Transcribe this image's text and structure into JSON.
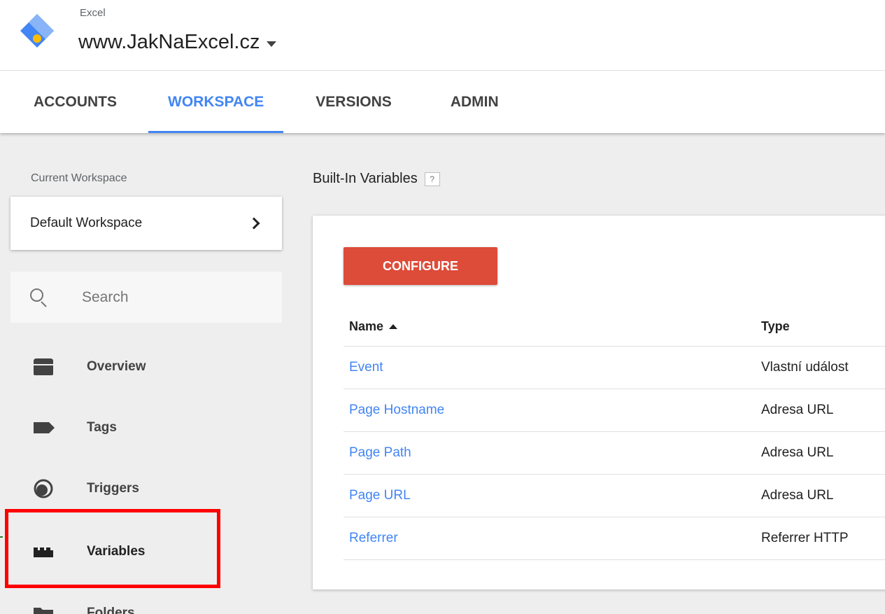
{
  "header": {
    "account": "Excel",
    "container": "www.JakNaExcel.cz",
    "brand_colors": {
      "blue": "#4285f4",
      "light_blue": "#8ab4f8",
      "yellow": "#fbbc04"
    }
  },
  "tabs": [
    {
      "label": "ACCOUNTS",
      "active": false
    },
    {
      "label": "WORKSPACE",
      "active": true
    },
    {
      "label": "VERSIONS",
      "active": false
    },
    {
      "label": "ADMIN",
      "active": false
    }
  ],
  "sidebar": {
    "workspace_label": "Current Workspace",
    "workspace_name": "Default Workspace",
    "search_placeholder": "Search",
    "items": [
      {
        "label": "Overview",
        "icon": "overview-icon"
      },
      {
        "label": "Tags",
        "icon": "tag-icon"
      },
      {
        "label": "Triggers",
        "icon": "trigger-icon"
      },
      {
        "label": "Variables",
        "icon": "variables-icon",
        "active": true
      },
      {
        "label": "Folders",
        "icon": "folder-icon"
      }
    ]
  },
  "main": {
    "section_title": "Built-In Variables",
    "help": "?",
    "configure_label": "CONFIGURE",
    "configure_color": "#dd4b39",
    "columns": {
      "name": "Name",
      "type": "Type"
    },
    "rows": [
      {
        "name": "Event",
        "type": "Vlastní událost"
      },
      {
        "name": "Page Hostname",
        "type": "Adresa URL"
      },
      {
        "name": "Page Path",
        "type": "Adresa URL"
      },
      {
        "name": "Page URL",
        "type": "Adresa URL"
      },
      {
        "name": "Referrer",
        "type": "Referrer HTTP"
      }
    ]
  }
}
